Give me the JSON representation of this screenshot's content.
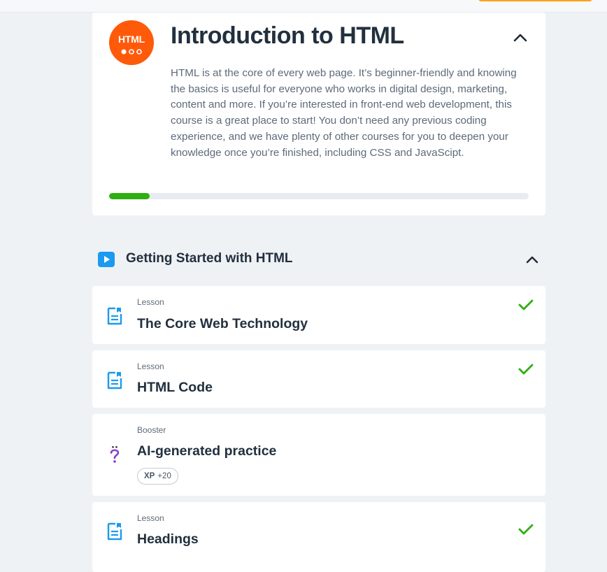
{
  "course": {
    "logo_text": "HTML",
    "title": "Introduction to HTML",
    "description": "HTML is at the core of every web page. It’s beginner-friendly and knowing the basics is useful for everyone who works in digital design, marketing, content and more. If you’re interested in front-end web development, this course is a great place to start! You don’t need any previous coding experience, and we have plenty of other courses for you to deepen your knowledge once you’re finished, including CSS and JavaScipt.",
    "progress_fraction": 0.097,
    "collapse_icon": "chevron-up-icon"
  },
  "section": {
    "icon": "play-icon",
    "title": "Getting Started with HTML",
    "collapse_icon": "chevron-up-icon"
  },
  "items": [
    {
      "type": "Lesson",
      "title": "The Core Web Technology",
      "icon": "lesson-document-icon",
      "completed": true
    },
    {
      "type": "Lesson",
      "title": "HTML Code",
      "icon": "lesson-document-icon",
      "completed": true
    },
    {
      "type": "Booster",
      "title": "AI-generated practice",
      "icon": "question-mark-icon",
      "completed": false,
      "xp_label": "XP",
      "xp_value": "+20"
    },
    {
      "type": "Lesson",
      "title": "Headings",
      "icon": "lesson-document-icon",
      "completed": true
    }
  ],
  "colors": {
    "brand_orange": "#ff5a0a",
    "progress_green": "#2fae12",
    "check_green": "#2fae12",
    "section_blue": "#1a9af0",
    "lesson_icon_blue": "#1a9af0",
    "booster_purple": "#8a3fd1",
    "background": "#eff2f5"
  }
}
